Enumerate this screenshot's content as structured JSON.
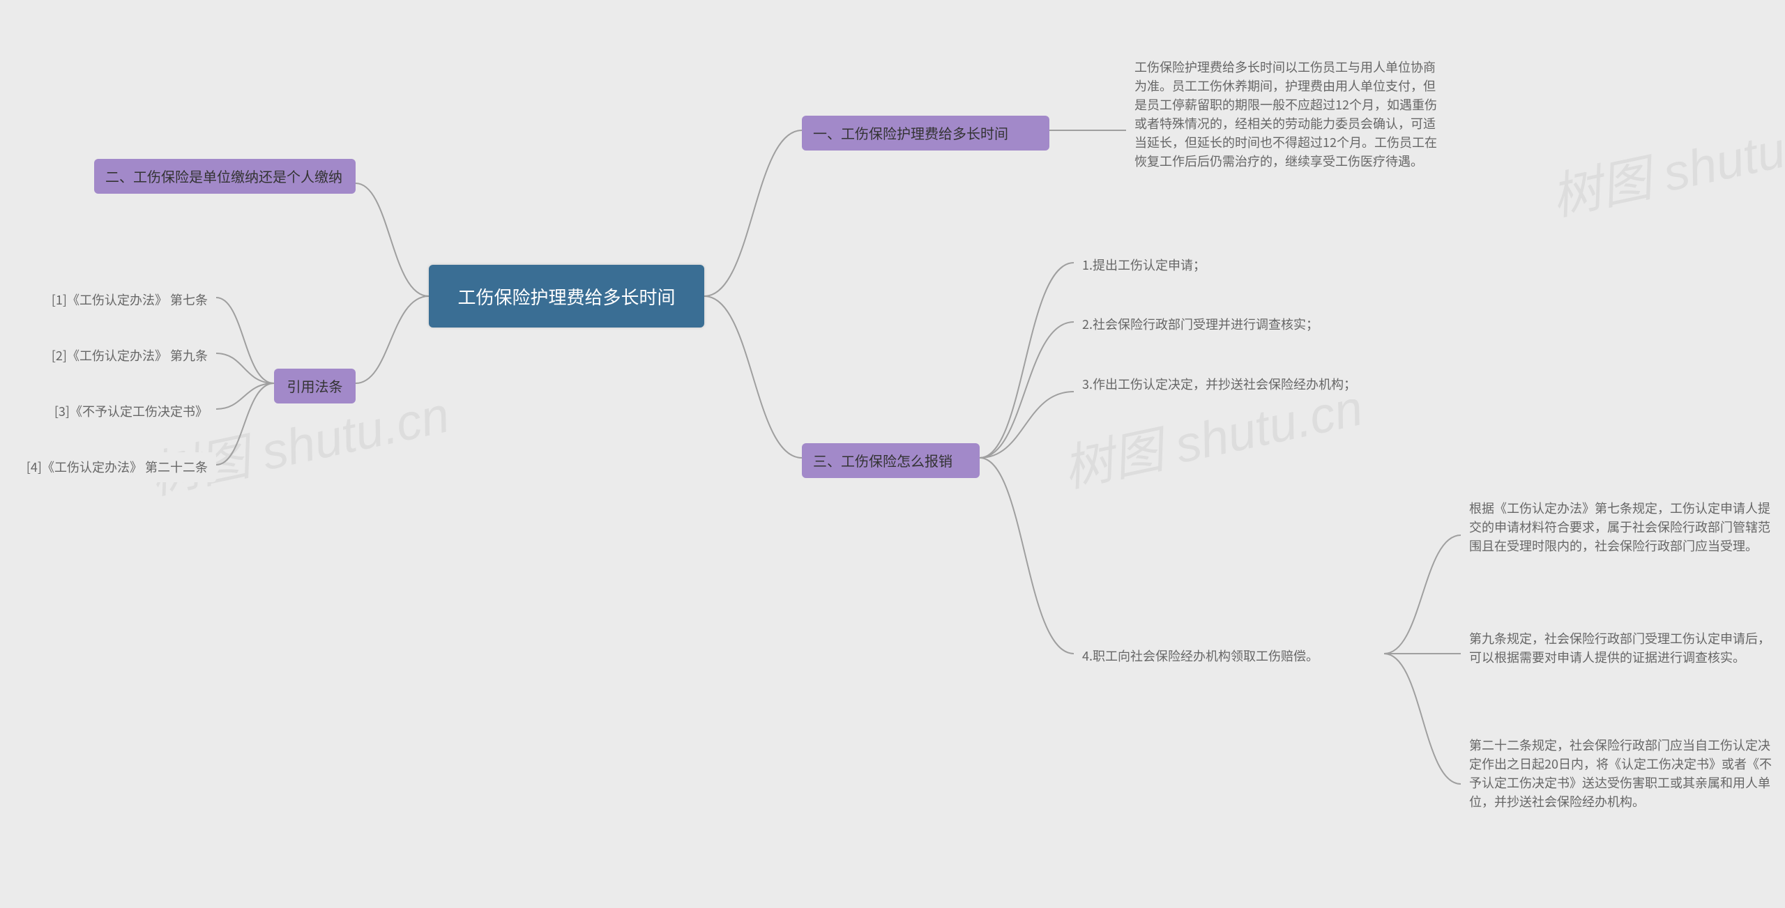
{
  "root": {
    "title": "工伤保险护理费给多长时间"
  },
  "right": {
    "branch1": {
      "title": "一、工伤保险护理费给多长时间",
      "detail": "工伤保险护理费给多长时间以工伤员工与用人单位协商为准。员工工伤休养期间，护理费由用人单位支付，但是员工停薪留职的期限一般不应超过12个月，如遇重伤或者特殊情况的，经相关的劳动能力委员会确认，可适当延长，但延长的时间也不得超过12个月。工伤员工在恢复工作后后仍需治疗的，继续享受工伤医疗待遇。"
    },
    "branch3": {
      "title": "三、工伤保险怎么报销",
      "step1": "1.提出工伤认定申请；",
      "step2": "2.社会保险行政部门受理并进行调查核实；",
      "step3": "3.作出工伤认定决定，并抄送社会保险经办机构；",
      "step4": "4.职工向社会保险经办机构领取工伤赔偿。",
      "detail4a": "根据《工伤认定办法》第七条规定，工伤认定申请人提交的申请材料符合要求，属于社会保险行政部门管辖范围且在受理时限内的，社会保险行政部门应当受理。",
      "detail4b": "第九条规定，社会保险行政部门受理工伤认定申请后，可以根据需要对申请人提供的证据进行调查核实。",
      "detail4c": "第二十二条规定，社会保险行政部门应当自工伤认定决定作出之日起20日内，将《认定工伤决定书》或者《不予认定工伤决定书》送达受伤害职工或其亲属和用人单位，并抄送社会保险经办机构。"
    }
  },
  "left": {
    "branch2": {
      "title": "二、工伤保险是单位缴纳还是个人缴纳"
    },
    "law": {
      "title": "引用法条",
      "item1": "[1]《工伤认定办法》 第七条",
      "item2": "[2]《工伤认定办法》 第九条",
      "item3": "[3]《不予认定工伤决定书》",
      "item4": "[4]《工伤认定办法》 第二十二条"
    }
  },
  "watermark": "树图 shutu.cn"
}
